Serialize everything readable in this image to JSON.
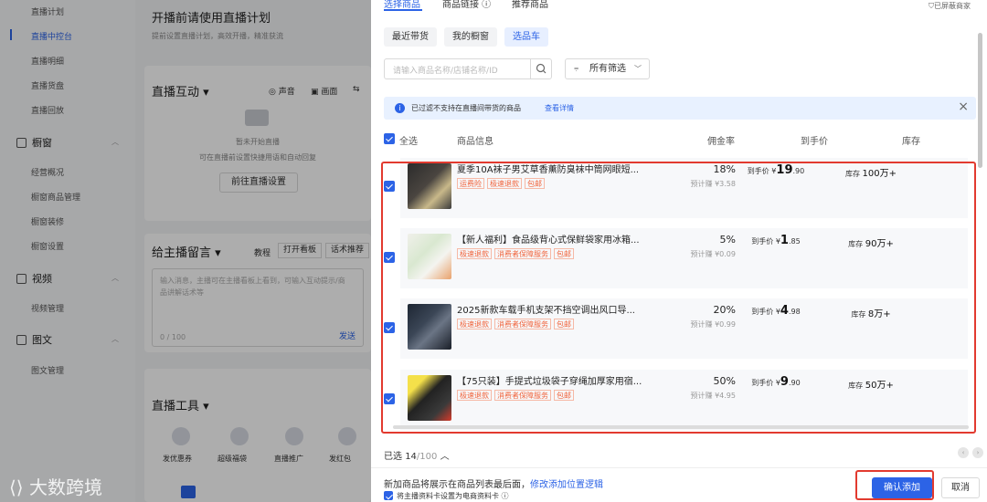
{
  "sidebar": {
    "items_top": [
      "直播计划",
      "直播中控台",
      "直播明细",
      "直播货盘",
      "直播回放"
    ],
    "section_window": "橱窗",
    "window_items": [
      "经营概况",
      "橱窗商品管理",
      "橱窗装修",
      "橱窗设置"
    ],
    "section_video": "视频",
    "video_items": [
      "视频管理"
    ],
    "section_article": "图文",
    "article_items": [
      "图文管理"
    ]
  },
  "center": {
    "plan_title": "开播前请使用直播计划",
    "plan_sub": "提前设置直播计划，高效开播，精准获流",
    "interact_title": "直播互动 ▾",
    "sound_label": "声音",
    "screen_label": "画面",
    "interact_empty1": "暂未开始直播",
    "interact_empty2": "可在直播前设置快捷用语和自动回复",
    "goto_settings": "前往直播设置",
    "msg_title": "给主播留言 ▾",
    "tutorial": "教程",
    "open_board": "打开看板",
    "script_rec": "话术推荐",
    "msg_placeholder": "输入消息，主播可在主播看板上看到，可输入互动提示/商品讲解话术等",
    "msg_count": "0 / 100",
    "send": "发送",
    "tools_title": "直播工具 ▾",
    "tools": [
      "发优惠券",
      "超级福袋",
      "直播推广",
      "发红包"
    ],
    "watermark": "大数跨境"
  },
  "panel": {
    "tabs": [
      "选择商品",
      "商品链接 ⓘ",
      "推荐商品"
    ],
    "blocked_shops": "已屏蔽商家",
    "subtabs": [
      "最近带货",
      "我的橱窗",
      "选品车"
    ],
    "search_placeholder": "请输入商品名称/店铺名称/ID",
    "filter_label": "所有筛选",
    "notice_text": "已过滤不支持在直播间带货的商品",
    "notice_link": "查看详情",
    "header": {
      "select_all": "全选",
      "info": "商品信息",
      "commission": "佣金率",
      "price": "到手价",
      "stock": "库存"
    },
    "products": [
      {
        "name": "夏季10A袜子男艾草香薰防臭袜中筒网眼短...",
        "tags": [
          "运费险",
          "极速退款",
          "包邮"
        ],
        "rate": "18%",
        "est": "预计赚 ¥3.58",
        "price_label": "到手价 ¥",
        "price_int": "19",
        "price_dec": ".90",
        "stock_label": "库存",
        "stock": "100万+"
      },
      {
        "name": "【新人福利】食品级背心式保鲜袋家用冰箱...",
        "tags": [
          "极速退款",
          "消费者保障服务",
          "包邮"
        ],
        "rate": "5%",
        "est": "预计赚 ¥0.09",
        "price_label": "到手价 ¥",
        "price_int": "1",
        "price_dec": ".85",
        "stock_label": "库存",
        "stock": "90万+"
      },
      {
        "name": "2025新款车载手机支架不挡空调出风口导...",
        "tags": [
          "极速退款",
          "消费者保障服务",
          "包邮"
        ],
        "rate": "20%",
        "est": "预计赚 ¥0.99",
        "price_label": "到手价 ¥",
        "price_int": "4",
        "price_dec": ".98",
        "stock_label": "库存",
        "stock": "8万+"
      },
      {
        "name": "【75只装】手提式垃圾袋子穿绳加厚家用宿...",
        "tags": [
          "极速退款",
          "消费者保障服务",
          "包邮"
        ],
        "rate": "50%",
        "est": "预计赚 ¥4.95",
        "price_label": "到手价 ¥",
        "price_int": "9",
        "price_dec": ".90",
        "stock_label": "库存",
        "stock": "50万+"
      }
    ],
    "selected_label": "已选",
    "selected_count": "14",
    "selected_max": "/100",
    "footer_note": "新加商品将展示在商品列表最后面，",
    "footer_link": "修改添加位置逻辑",
    "footer_check_label": "将主播资料卡设置为电商资料卡 ⓘ",
    "confirm": "确认添加",
    "cancel": "取消"
  }
}
